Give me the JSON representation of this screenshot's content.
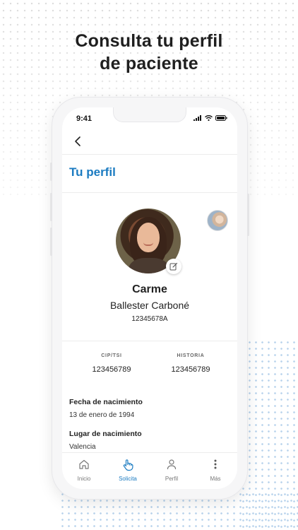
{
  "headline": {
    "line1": "Consulta tu perfil",
    "line2": "de paciente"
  },
  "status_bar": {
    "time": "9:41"
  },
  "page": {
    "title": "Tu perfil"
  },
  "profile": {
    "first_name": "Carme",
    "last_name": "Ballester Carboné",
    "document_id": "12345678A",
    "cip_label": "CIP/TSI",
    "cip_value": "123456789",
    "history_label": "HISTORIA",
    "history_value": "123456789"
  },
  "details": [
    {
      "label": "Fecha de nacimiento",
      "value": "13 de enero de 1994"
    },
    {
      "label": "Lugar de nacimiento",
      "value": "Valencia"
    }
  ],
  "tabs": [
    {
      "label": "Inicio",
      "icon": "home-icon",
      "active": false
    },
    {
      "label": "Solicita",
      "icon": "tap-hand-icon",
      "active": true
    },
    {
      "label": "Perfil",
      "icon": "person-icon",
      "active": false
    },
    {
      "label": "Más",
      "icon": "more-vertical-icon",
      "active": false
    }
  ],
  "colors": {
    "accent": "#1b7bc1",
    "text": "#222222",
    "muted": "#777777"
  }
}
